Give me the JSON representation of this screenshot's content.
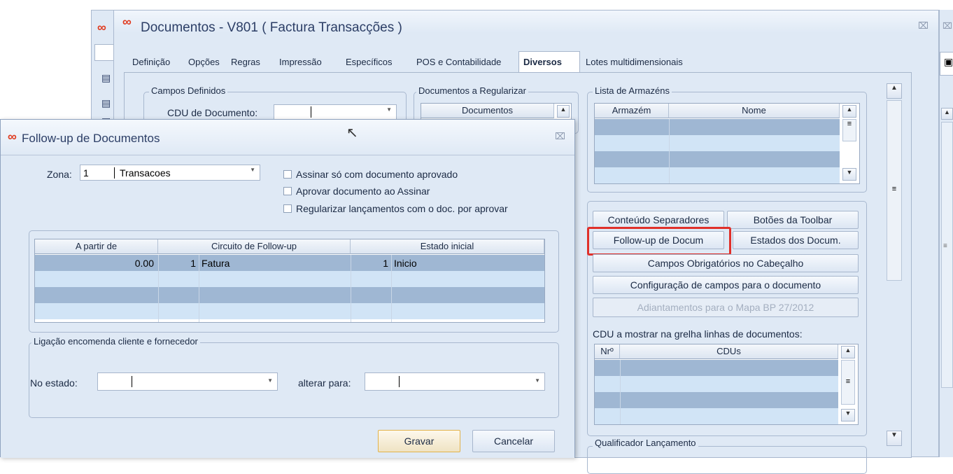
{
  "background_window": {
    "logo": "∞"
  },
  "main_window": {
    "logo": "∞",
    "title": "Documentos - V801 ( Factura Transacções )",
    "tabs": [
      {
        "label": "Definição"
      },
      {
        "label": "Opções"
      },
      {
        "label": "Regras"
      },
      {
        "label": "Impressão"
      },
      {
        "label": "Específicos"
      },
      {
        "label": "POS e Contabilidade"
      },
      {
        "label": "Diversos"
      },
      {
        "label": "Lotes multidimensionais"
      }
    ],
    "campos_definidos": {
      "title": "Campos Definidos",
      "cdu_label": "CDU de Documento:"
    },
    "documentos_regularizar": {
      "title": "Documentos a Regularizar",
      "col": "Documentos"
    },
    "lista_armazens": {
      "title": "Lista de Armazéns",
      "col1": "Armazém",
      "col2": "Nome"
    },
    "buttons": {
      "conteudo": "Conteúdo Separadores",
      "botoes_toolbar": "Botões da Toolbar",
      "follow_up": "Follow-up de Docum",
      "estados": "Estados dos Docum.",
      "campos_obrig": "Campos Obrigatórios no Cabeçalho",
      "config_campos": "Configuração de campos para o documento",
      "adiantamentos": "Adiantamentos para o Mapa BP 27/2012"
    },
    "cdu_grid": {
      "label": "CDU a mostrar na grelha linhas de documentos:",
      "col1": "Nrº",
      "col2": "CDUs"
    },
    "qualificador": {
      "title": "Qualificador Lançamento"
    },
    "highlight_color": "#e0302a"
  },
  "dialog": {
    "logo": "∞",
    "title": "Follow-up de Documentos",
    "zona_label": "Zona:",
    "zona_code": "1",
    "zona_value": "Transacoes",
    "checkboxes": [
      {
        "label": "Assinar só com documento aprovado",
        "checked": false
      },
      {
        "label": "Aprovar documento ao Assinar",
        "checked": false
      },
      {
        "label": "Regularizar lançamentos com o doc. por aprovar",
        "checked": false
      }
    ],
    "grid": {
      "headers": [
        "A partir de",
        "Circuito de Follow-up",
        "Estado inicial"
      ],
      "rows": [
        {
          "a_partir": "0.00",
          "circ_num": "1",
          "circ_name": "Fatura",
          "estado_num": "1",
          "estado_name": "Inicio"
        }
      ]
    },
    "ligacao": {
      "title": "Ligação encomenda cliente e fornecedor",
      "no_estado_label": "No estado:",
      "alterar_label": "alterar para:"
    },
    "gravar": "Gravar",
    "cancelar": "Cancelar"
  }
}
